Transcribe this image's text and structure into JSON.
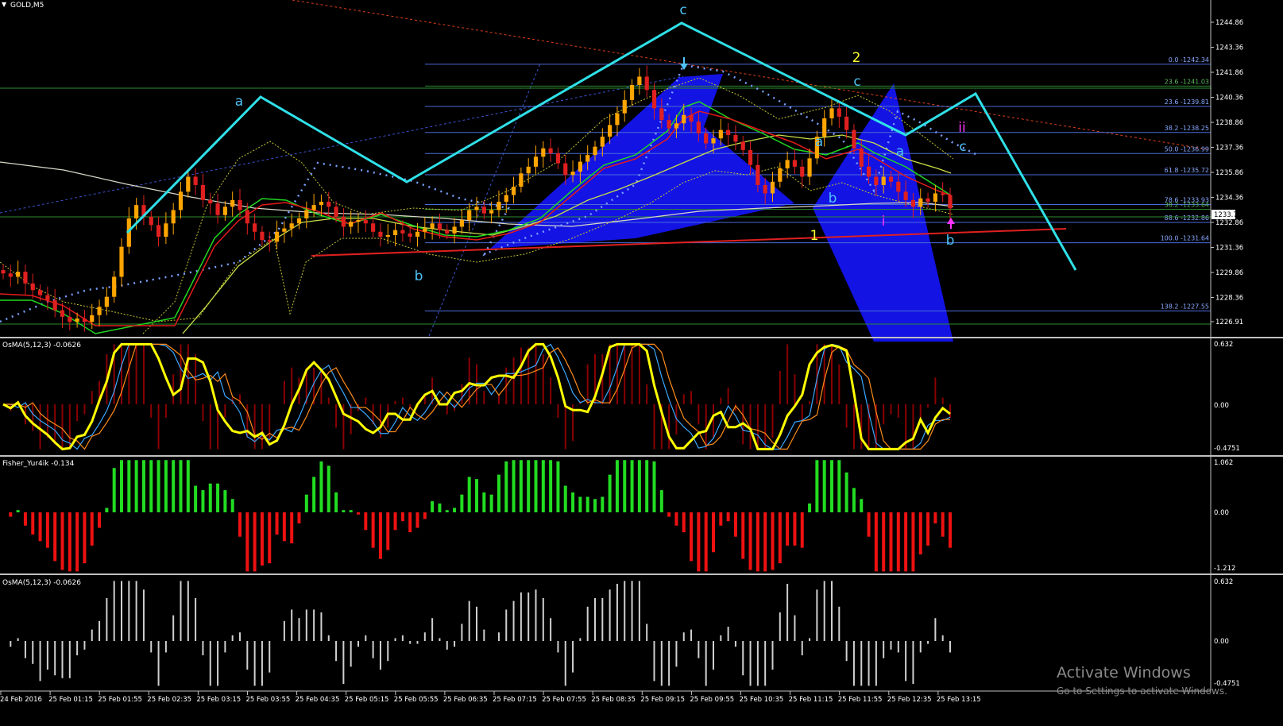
{
  "window": {
    "title_arrow": "▼",
    "title": "GOLD,M5"
  },
  "price_axis": {
    "ticks": [
      "1244.86",
      "1243.36",
      "1241.86",
      "1240.36",
      "1238.86",
      "1237.36",
      "1235.86",
      "1234.36",
      "1232.86",
      "1231.36",
      "1229.86",
      "1228.36",
      "1226.91"
    ],
    "current_price": "1233.77"
  },
  "fib_levels": [
    {
      "label": "0.0 -1242.34",
      "price": 1242.34,
      "color": "#4a6cd8"
    },
    {
      "label": "23.6 -1241.03",
      "price": 1241.03,
      "color": "#2e8b2e"
    },
    {
      "label": "23.6 -1239.81",
      "price": 1239.81,
      "color": "#4a6cd8"
    },
    {
      "label": "38.2 -1238.25",
      "price": 1238.25,
      "color": "#4a6cd8"
    },
    {
      "label": "50.0 -1236.99",
      "price": 1236.99,
      "color": "#4a6cd8"
    },
    {
      "label": "61.8 -1235.72",
      "price": 1235.72,
      "color": "#4a6cd8"
    },
    {
      "label": "78.6 -1233.93",
      "price": 1233.93,
      "color": "#4a6cd8"
    },
    {
      "label": "38.2 -1233.64",
      "price": 1233.64,
      "color": "#2e8b2e"
    },
    {
      "label": "88.6 -1232.86",
      "price": 1232.86,
      "color": "#4a6cd8"
    },
    {
      "label": "100.0 -1231.64",
      "price": 1231.64,
      "color": "#4a6cd8"
    },
    {
      "label": "138.2 -1227.55",
      "price": 1227.55,
      "color": "#4a6cd8"
    }
  ],
  "wave_labels": [
    {
      "text": "c",
      "color": "#4fc3f7"
    },
    {
      "text": "a",
      "color": "#4fc3f7"
    },
    {
      "text": "b",
      "color": "#4fc3f7"
    },
    {
      "text": "2",
      "color": "#ffff33"
    },
    {
      "text": "c",
      "color": "#4fc3f7"
    },
    {
      "text": "ii",
      "color": "#ff33ff"
    },
    {
      "text": "c",
      "color": "#4fc3f7"
    },
    {
      "text": "a",
      "color": "#4fc3f7"
    },
    {
      "text": "a",
      "color": "#4fc3f7"
    },
    {
      "text": "b",
      "color": "#4fc3f7"
    },
    {
      "text": "1",
      "color": "#ffff33"
    },
    {
      "text": "i",
      "color": "#ff33ff"
    },
    {
      "text": "b",
      "color": "#4fc3f7"
    }
  ],
  "panels": {
    "osma1": {
      "label": "OsMA(5,12,3) -0.0626",
      "ticks": [
        "0.632",
        "0.00",
        "-0.4751"
      ]
    },
    "fisher": {
      "label": "Fisher_Yur4ik -0.134",
      "ticks": [
        "1.062",
        "0.00",
        "-1.212"
      ]
    },
    "osma2": {
      "label": "OsMA(5,12,3) -0.0626",
      "ticks": [
        "0.632",
        "0.00",
        "-0.4751"
      ]
    }
  },
  "time_axis": [
    "24 Feb 2016",
    "25 Feb 01:15",
    "25 Feb 01:55",
    "25 Feb 02:35",
    "25 Feb 03:15",
    "25 Feb 03:55",
    "25 Feb 04:35",
    "25 Feb 05:15",
    "25 Feb 05:55",
    "25 Feb 06:35",
    "25 Feb 07:15",
    "25 Feb 07:55",
    "25 Feb 08:35",
    "25 Feb 09:15",
    "25 Feb 09:55",
    "25 Feb 10:35",
    "25 Feb 11:15",
    "25 Feb 11:55",
    "25 Feb 12:35",
    "25 Feb 13:15"
  ],
  "watermark": {
    "line1": "Activate Windows",
    "line2": "Go to Settings to activate Windows."
  },
  "colors": {
    "bull_candle": "#ffa500",
    "bear_candle": "#e02020",
    "elliott": "#2fe0e8",
    "pattern": "#1a1aff",
    "yellow_line": "#ffff00",
    "fisher_up": "#22dd22",
    "fisher_down": "#ee1111",
    "hist_grey": "#d0d0d0",
    "hist_red": "#8b0000"
  },
  "chart_data": {
    "type": "candlestick",
    "symbol": "GOLD",
    "timeframe": "M5",
    "ylim": [
      1226.91,
      1245.5
    ],
    "close_series": [
      1229.8,
      1229.6,
      1229.9,
      1229.2,
      1228.8,
      1228.5,
      1228.2,
      1227.6,
      1227.2,
      1226.9,
      1227.1,
      1226.9,
      1227.3,
      1227.8,
      1228.4,
      1229.6,
      1231.4,
      1233.1,
      1233.9,
      1233.2,
      1232.7,
      1232.0,
      1232.8,
      1233.6,
      1234.7,
      1235.6,
      1235.1,
      1234.2,
      1234.0,
      1233.3,
      1233.8,
      1234.2,
      1233.6,
      1232.8,
      1232.3,
      1231.8,
      1231.7,
      1232.3,
      1232.5,
      1232.8,
      1233.1,
      1233.6,
      1233.9,
      1234.1,
      1233.8,
      1233.2,
      1232.6,
      1232.9,
      1233.0,
      1232.8,
      1232.3,
      1232.0,
      1232.1,
      1232.4,
      1232.2,
      1232.0,
      1232.3,
      1232.5,
      1232.8,
      1232.4,
      1232.2,
      1232.6,
      1233.0,
      1233.6,
      1233.8,
      1233.4,
      1233.6,
      1234.1,
      1234.5,
      1235.0,
      1235.8,
      1236.2,
      1236.8,
      1237.3,
      1237.0,
      1236.4,
      1235.7,
      1235.9,
      1236.5,
      1236.9,
      1237.4,
      1238.0,
      1238.7,
      1239.4,
      1240.2,
      1241.1,
      1241.6,
      1240.8,
      1239.7,
      1239.0,
      1238.5,
      1238.8,
      1239.3,
      1238.9,
      1238.2,
      1237.6,
      1237.9,
      1238.4,
      1238.1,
      1237.7,
      1237.2,
      1236.3,
      1235.1,
      1234.6,
      1235.3,
      1236.1,
      1236.6,
      1236.2,
      1235.6,
      1236.7,
      1238.0,
      1239.1,
      1239.7,
      1239.2,
      1238.4,
      1237.3,
      1236.2,
      1235.6,
      1235.1,
      1235.6,
      1235.3,
      1234.7,
      1234.2,
      1233.8,
      1234.3,
      1234.1,
      1234.6,
      1234.5,
      1233.7
    ]
  }
}
